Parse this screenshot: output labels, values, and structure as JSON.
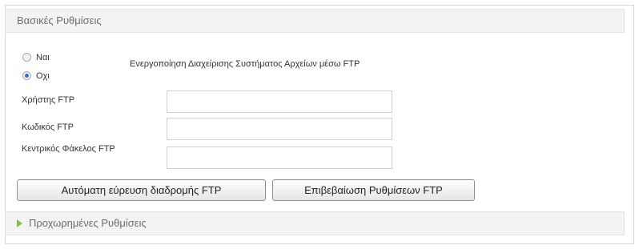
{
  "sections": {
    "basic_title": "Βασικές Ρυθμίσεις",
    "advanced_title": "Προχωρημένες Ρυθμίσεις"
  },
  "ftp_enable": {
    "option_yes": "Ναι",
    "option_no": "Οχι",
    "selected": "Οχι",
    "description": "Ενεργοποίηση Διαχείρισης Συστήματος Αρχείων μέσω FTP"
  },
  "fields": {
    "user_label": "Χρήστης FTP",
    "user_value": "",
    "pass_label": "Κωδικός FTP",
    "pass_value": "",
    "root_label": "Κεντρικός Φάκελος FTP",
    "root_value": ""
  },
  "buttons": {
    "autodetect": "Αυτόματη εύρευση διαδρομής FTP",
    "verify": "Επιβεβαίωση Ρυθμίσεων FTP"
  },
  "colors": {
    "accent_arrow": "#7cc24e",
    "radio_selected": "#2f6fd0"
  }
}
